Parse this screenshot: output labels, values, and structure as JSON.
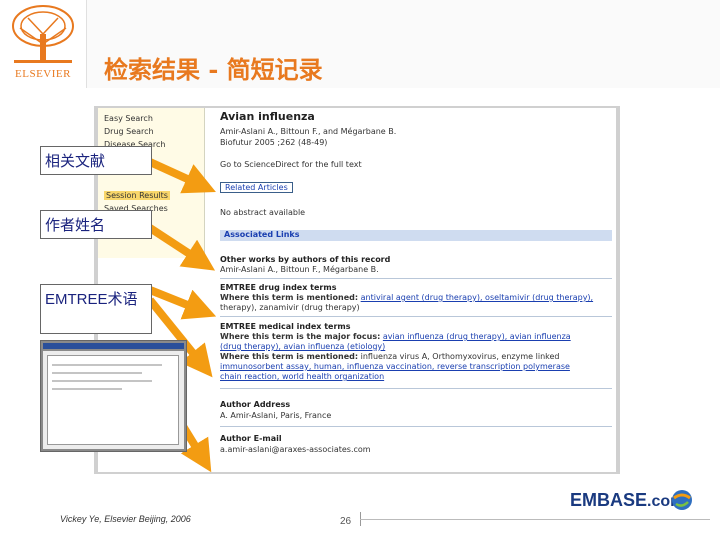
{
  "slide": {
    "title": "检索结果 - 简短记录",
    "footer_text": "Vickey Ye, Elsevier Beijing, 2006",
    "page_number": "26"
  },
  "brand": {
    "logo_text": "ELSEVIER",
    "product_logo": "EMBASE",
    "product_suffix": ".com",
    "accent_color": "#e8791f"
  },
  "callouts": [
    {
      "label": "相关文献"
    },
    {
      "label": "作者姓名"
    },
    {
      "label": "EMTREE术语"
    }
  ],
  "nav": {
    "items": [
      {
        "label": "Easy Search",
        "highlighted": false
      },
      {
        "label": "Drug Search",
        "highlighted": false
      },
      {
        "label": "Disease Search",
        "highlighted": false
      },
      {
        "label": "Session Results",
        "highlighted": true
      },
      {
        "label": "Saved Searches",
        "highlighted": false
      }
    ]
  },
  "record": {
    "title": "Avian influenza",
    "authors": "Amir-Aslani A., Bittoun F., and Mégarbane B.",
    "source": "Biofutur 2005 ;262 (48-49)",
    "fulltext_link": "Go to ScienceDirect for the full text",
    "related_articles": "Related Articles",
    "no_abstract": "No abstract available",
    "associated_links": "Associated Links",
    "other_works_heading": "Other works by authors of this record",
    "other_works_authors": "Amir-Aslani A., Bittoun F., Mégarbane B.",
    "drug_terms_heading": "EMTREE drug index terms",
    "drug_terms_lead": "Where this term is mentioned:",
    "drug_terms_line1": "antiviral agent (drug therapy), oseltamivir (drug therapy),",
    "drug_terms_line2": "therapy), zanamivir (drug therapy)",
    "medical_terms_heading": "EMTREE medical index terms",
    "major_focus_lead": "Where this term is the major focus:",
    "major_focus_terms": "avian influenza (drug therapy), avian influenza",
    "major_focus_line2": "(drug therapy), avian influenza (etiology)",
    "mentioned_lead": "Where this term is mentioned:",
    "mentioned_line1": "influenza virus A, Orthomyxovirus, enzyme linked",
    "mentioned_line2": "immunosorbent assay, human, influenza vaccination, reverse transcription polymerase",
    "mentioned_line3": "chain reaction, world health organization",
    "author_address_heading": "Author Address",
    "author_address": "A. Amir-Aslani, Paris, France",
    "author_email_heading": "Author E-mail",
    "author_email": "a.amir-aslani@araxes-associates.com"
  }
}
